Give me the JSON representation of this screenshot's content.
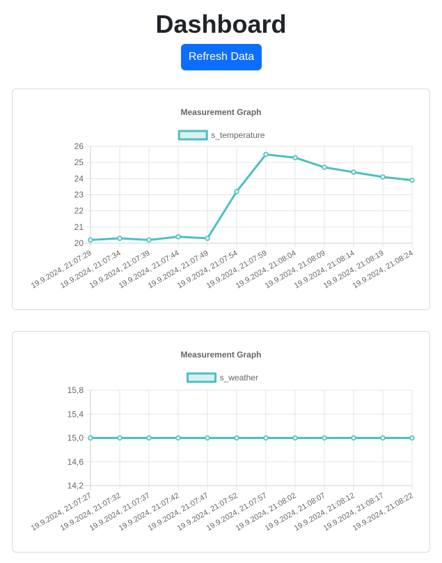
{
  "header": {
    "title": "Dashboard",
    "refresh_label": "Refresh Data"
  },
  "colors": {
    "line": "#4bc0c0",
    "fill": "#d8f1f1",
    "button": "#0d6efd"
  },
  "chart_data": [
    {
      "type": "line",
      "title": "Measurement Graph",
      "legend_position": "top",
      "grid": true,
      "ylim": [
        20,
        26
      ],
      "y_ticks": [
        "26",
        "25",
        "24",
        "23",
        "22",
        "21",
        "20"
      ],
      "categories": [
        "19.9.2024, 21:07:29",
        "19.9.2024, 21:07:34",
        "19.9.2024, 21:07:39",
        "19.9.2024, 21:07:44",
        "19.9.2024, 21:07:49",
        "19.9.2024, 21:07:54",
        "19.9.2024, 21:07:59",
        "19.9.2024, 21:08:04",
        "19.9.2024, 21:08:09",
        "19.9.2024, 21:08:14",
        "19.9.2024, 21:08:19",
        "19.9.2024, 21:08:24"
      ],
      "series": [
        {
          "name": "s_temperature",
          "values": [
            20.2,
            20.3,
            20.2,
            20.4,
            20.3,
            23.2,
            25.5,
            25.3,
            24.7,
            24.4,
            24.1,
            23.9
          ]
        }
      ]
    },
    {
      "type": "line",
      "title": "Measurement Graph",
      "legend_position": "top",
      "grid": true,
      "ylim": [
        14.2,
        15.8
      ],
      "y_ticks": [
        "15,8",
        "15,4",
        "15,0",
        "14,6",
        "14,2"
      ],
      "categories": [
        "19.9.2024, 21:07:27",
        "19.9.2024, 21:07:32",
        "19.9.2024, 21:07:37",
        "19.9.2024, 21:07:42",
        "19.9.2024, 21:07:47",
        "19.9.2024, 21:07:52",
        "19.9.2024, 21:07:57",
        "19.9.2024, 21:08:02",
        "19.9.2024, 21:08:07",
        "19.9.2024, 21:08:12",
        "19.9.2024, 21:08:17",
        "19.9.2024, 21:08:22"
      ],
      "series": [
        {
          "name": "s_weather",
          "values": [
            15,
            15,
            15,
            15,
            15,
            15,
            15,
            15,
            15,
            15,
            15,
            15
          ]
        }
      ]
    }
  ]
}
